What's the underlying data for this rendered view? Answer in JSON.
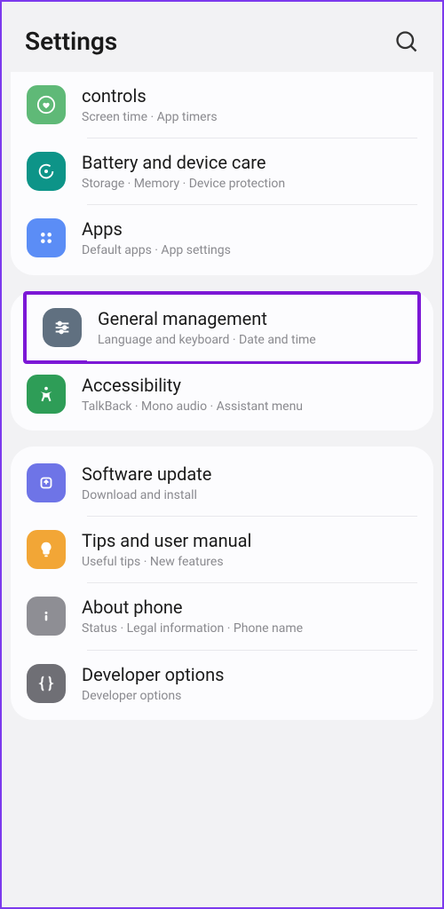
{
  "header": {
    "title": "Settings"
  },
  "cards": [
    {
      "items": [
        {
          "title": "controls",
          "sub": "Screen time  ·  App timers",
          "icon": "heart-circle-icon",
          "bg": "bg-green"
        },
        {
          "title": "Battery and device care",
          "sub": "Storage  ·  Memory  ·  Device protection",
          "icon": "refresh-icon",
          "bg": "bg-teal"
        },
        {
          "title": "Apps",
          "sub": "Default apps  ·  App settings",
          "icon": "grid-icon",
          "bg": "bg-blue"
        }
      ]
    },
    {
      "items": [
        {
          "title": "General management",
          "sub": "Language and keyboard  ·  Date and time",
          "icon": "sliders-icon",
          "bg": "bg-slate",
          "highlighted": true
        },
        {
          "title": "Accessibility",
          "sub": "TalkBack  ·  Mono audio  ·  Assistant menu",
          "icon": "accessibility-icon",
          "bg": "bg-green2"
        }
      ]
    },
    {
      "items": [
        {
          "title": "Software update",
          "sub": "Download and install",
          "icon": "update-icon",
          "bg": "bg-indigo"
        },
        {
          "title": "Tips and user manual",
          "sub": "Useful tips  ·  New features",
          "icon": "bulb-icon",
          "bg": "bg-orange"
        },
        {
          "title": "About phone",
          "sub": "Status  ·  Legal information  ·  Phone name",
          "icon": "info-icon",
          "bg": "bg-gray"
        },
        {
          "title": "Developer options",
          "sub": "Developer options",
          "icon": "braces-icon",
          "bg": "bg-darkg"
        }
      ]
    }
  ]
}
